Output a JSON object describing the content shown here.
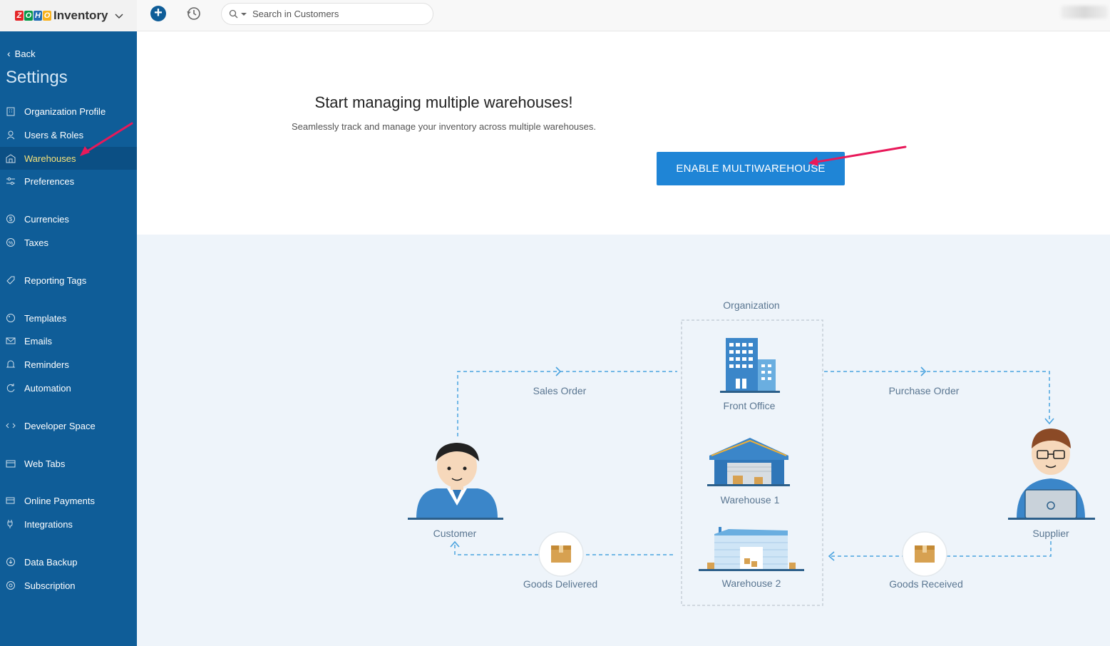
{
  "app": {
    "name": "Inventory",
    "logo_letters": [
      "Z",
      "O",
      "H",
      "O"
    ]
  },
  "search": {
    "placeholder": "Search in Customers"
  },
  "sidebar": {
    "back_label": "Back",
    "title": "Settings",
    "items": [
      {
        "label": "Organization Profile",
        "icon": "building-icon"
      },
      {
        "label": "Users & Roles",
        "icon": "users-icon"
      },
      {
        "label": "Warehouses",
        "icon": "warehouse-icon",
        "active": true
      },
      {
        "label": "Preferences",
        "icon": "sliders-icon"
      },
      {
        "label": "Currencies",
        "icon": "currency-icon"
      },
      {
        "label": "Taxes",
        "icon": "percent-icon"
      },
      {
        "label": "Reporting Tags",
        "icon": "tag-icon"
      },
      {
        "label": "Templates",
        "icon": "palette-icon"
      },
      {
        "label": "Emails",
        "icon": "mail-icon"
      },
      {
        "label": "Reminders",
        "icon": "bell-icon"
      },
      {
        "label": "Automation",
        "icon": "automation-icon"
      },
      {
        "label": "Developer Space",
        "icon": "code-icon"
      },
      {
        "label": "Web Tabs",
        "icon": "tabs-icon"
      },
      {
        "label": "Online Payments",
        "icon": "payment-icon"
      },
      {
        "label": "Integrations",
        "icon": "plug-icon"
      },
      {
        "label": "Data Backup",
        "icon": "backup-icon"
      },
      {
        "label": "Subscription",
        "icon": "subscription-icon"
      }
    ]
  },
  "main": {
    "headline": "Start managing multiple warehouses!",
    "subline": "Seamlessly track and manage your inventory across multiple warehouses.",
    "enable_button": "ENABLE MULTIWAREHOUSE"
  },
  "diagram": {
    "organization": "Organization",
    "front_office": "Front Office",
    "warehouse_1": "Warehouse 1",
    "warehouse_2": "Warehouse 2",
    "customer": "Customer",
    "supplier": "Supplier",
    "sales_order": "Sales Order",
    "purchase_order": "Purchase Order",
    "goods_delivered": "Goods Delivered",
    "goods_received": "Goods Received"
  },
  "colors": {
    "sidebar": "#0f5d98",
    "accent": "#1f85d6",
    "annotation_arrow": "#e8195a"
  }
}
